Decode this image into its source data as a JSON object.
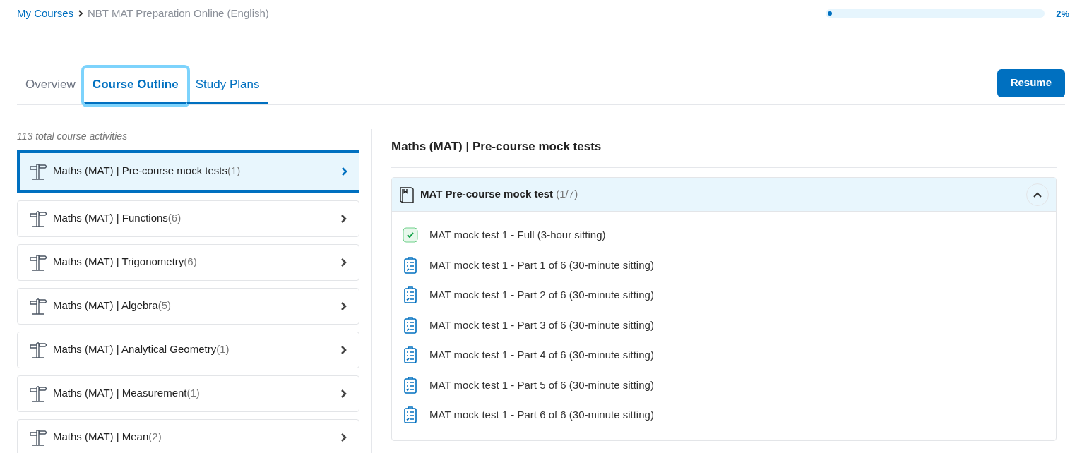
{
  "breadcrumb": [
    {
      "label": "My Courses",
      "link": true
    },
    {
      "label": "NBT MAT Preparation Online (English)",
      "link": false
    }
  ],
  "progress": {
    "level": 0.02,
    "reading": "2%"
  },
  "tabs": [
    {
      "label": "Overview",
      "selected": false
    },
    {
      "label": "Course Outline",
      "selected": true
    },
    {
      "label": "Study Plans",
      "selected": false
    }
  ],
  "resume_button": "Resume",
  "activities_count": "113 total course activities",
  "sections": [
    {
      "name": "Maths (MAT) | Pre-course mock tests",
      "count": "(1)",
      "selected": true
    },
    {
      "name": "Maths (MAT) | Functions",
      "count": "(6)",
      "selected": false
    },
    {
      "name": "Maths (MAT) | Trigonometry",
      "count": "(6)",
      "selected": false
    },
    {
      "name": "Maths (MAT) | Algebra",
      "count": "(5)",
      "selected": false
    },
    {
      "name": "Maths (MAT) | Analytical Geometry",
      "count": "(1)",
      "selected": false
    },
    {
      "name": "Maths (MAT) | Measurement",
      "count": "(1)",
      "selected": false
    },
    {
      "name": "Maths (MAT) | Mean",
      "count": "(2)",
      "selected": false
    }
  ],
  "detail": {
    "title": "Maths (MAT) | Pre-course mock tests",
    "group": {
      "title": "MAT Pre-course mock test",
      "count": "(1/7)",
      "expanded": true,
      "activities": [
        {
          "kind": "completed",
          "label": "MAT mock test 1 - Full (3-hour sitting)"
        },
        {
          "kind": "quiz",
          "label": "MAT mock test 1 - Part 1 of 6 (30-minute sitting)"
        },
        {
          "kind": "quiz",
          "label": "MAT mock test 1 - Part 2 of 6 (30-minute sitting)"
        },
        {
          "kind": "quiz",
          "label": "MAT mock test 1 - Part 3 of 6 (30-minute sitting)"
        },
        {
          "kind": "quiz",
          "label": "MAT mock test 1 - Part 4 of 6 (30-minute sitting)"
        },
        {
          "kind": "quiz",
          "label": "MAT mock test 1 - Part 5 of 6 (30-minute sitting)"
        },
        {
          "kind": "quiz",
          "label": "MAT mock test 1 - Part 6 of 6 (30-minute sitting)"
        }
      ]
    }
  }
}
